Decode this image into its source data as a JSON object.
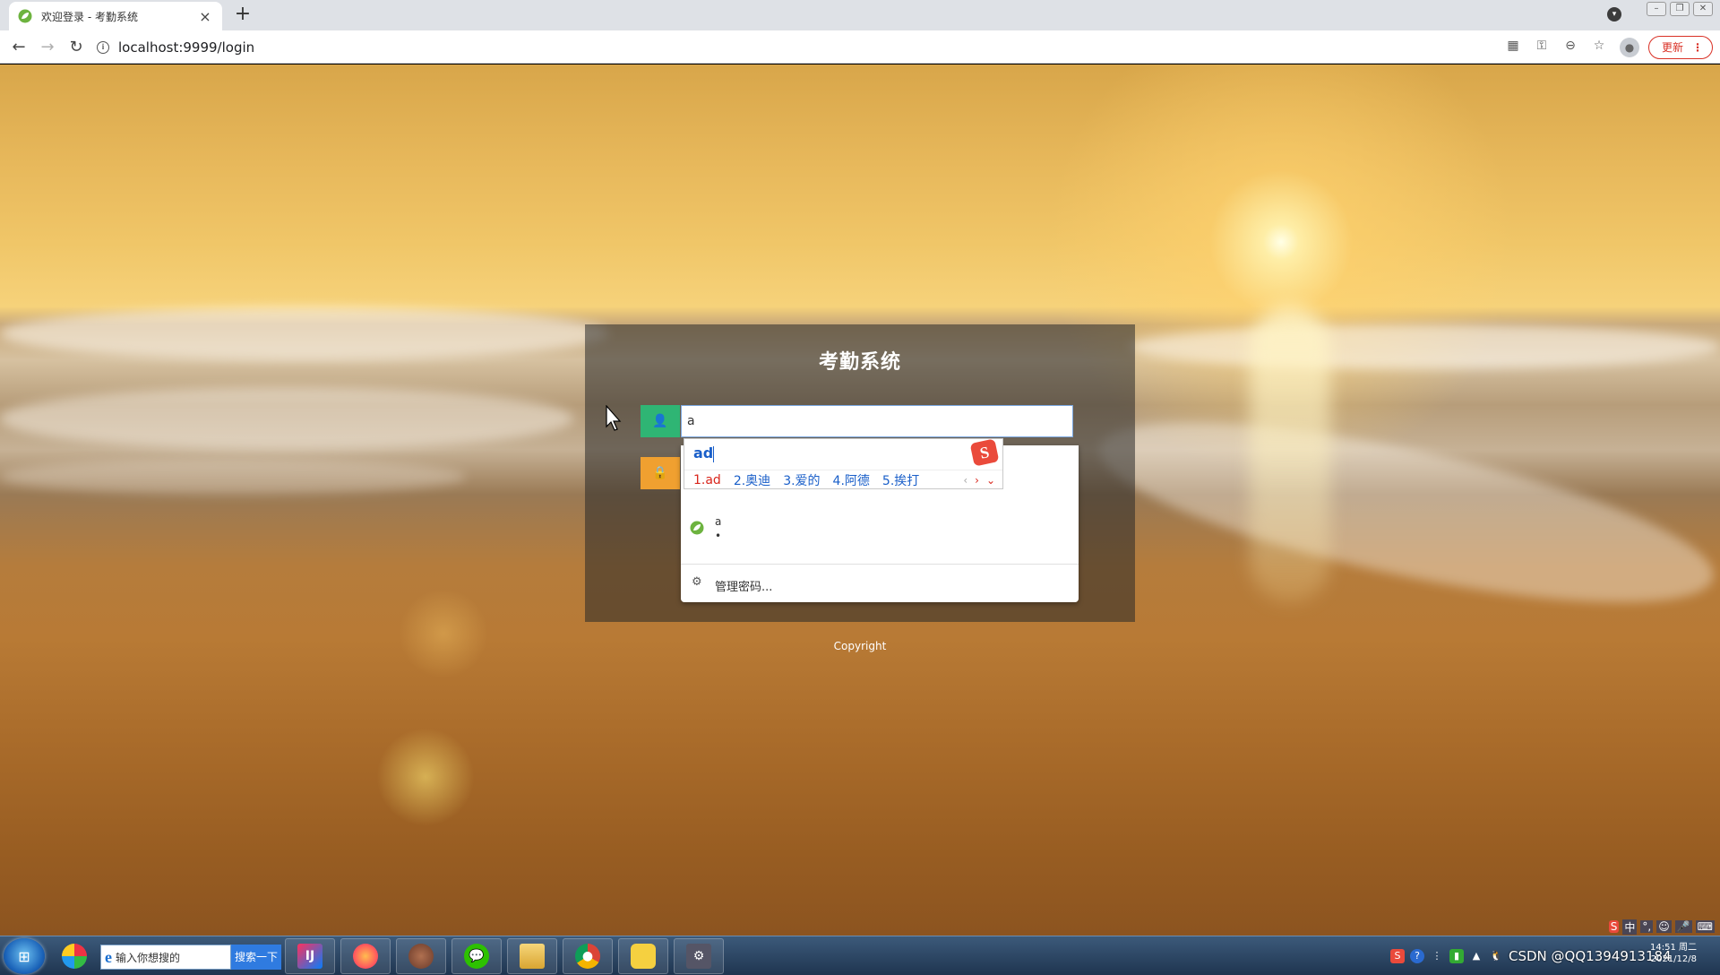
{
  "browser": {
    "tab_title": "欢迎登录 - 考勤系统",
    "tab_close": "×",
    "new_tab": "+",
    "url": "localhost:9999/login",
    "update_button": "更新",
    "update_menu": "⋮",
    "back": "←",
    "forward": "→",
    "reload": "↻"
  },
  "login": {
    "title": "考勤系统",
    "username_value": "a",
    "copyright": "Copyright"
  },
  "autofill": {
    "saved_password_mask": "•••••",
    "suggestion_user": "a",
    "suggestion_password": "•",
    "manage_label": "管理密码..."
  },
  "ime": {
    "composition": "ad",
    "logo": "S",
    "candidates": [
      "1.ad",
      "2.奥迪",
      "3.爱的",
      "4.阿德",
      "5.挨打"
    ],
    "prev": "‹",
    "next": "›",
    "expand": "⌄"
  },
  "taskbar": {
    "search_placeholder": "输入你想搜的",
    "search_button": "搜索一下",
    "tray_text": "CSDN @QQ1394913184",
    "clock_time": "14:51 周二",
    "clock_date": "2021/12/8",
    "ime_tray": [
      "中",
      "°,",
      "☺",
      "🎤",
      "⌨"
    ]
  },
  "colors": {
    "user_icon_bg": "#2fb574",
    "lock_icon_bg": "#f0a030",
    "login_btn": "#19a7c9",
    "ime_accent": "#d9261c",
    "ime_blue": "#1a5fc9"
  }
}
